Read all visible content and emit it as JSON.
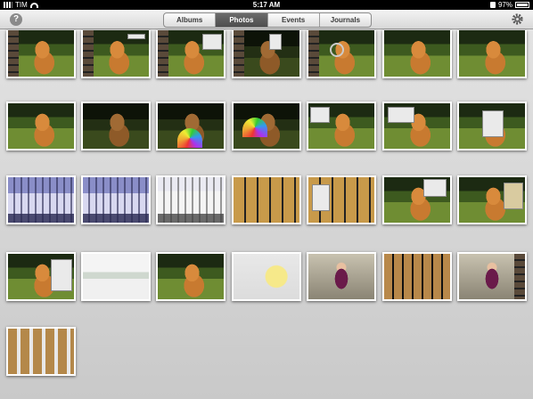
{
  "status_bar": {
    "carrier": "TIM",
    "time": "5:17 AM",
    "battery": "97%"
  },
  "toolbar": {
    "help_label": "?",
    "tabs": [
      {
        "label": "Albums",
        "active": false
      },
      {
        "label": "Photos",
        "active": true
      },
      {
        "label": "Events",
        "active": false
      },
      {
        "label": "Journals",
        "active": false
      }
    ],
    "settings_icon": "gear-icon"
  },
  "photos": {
    "count_visible": 29
  }
}
